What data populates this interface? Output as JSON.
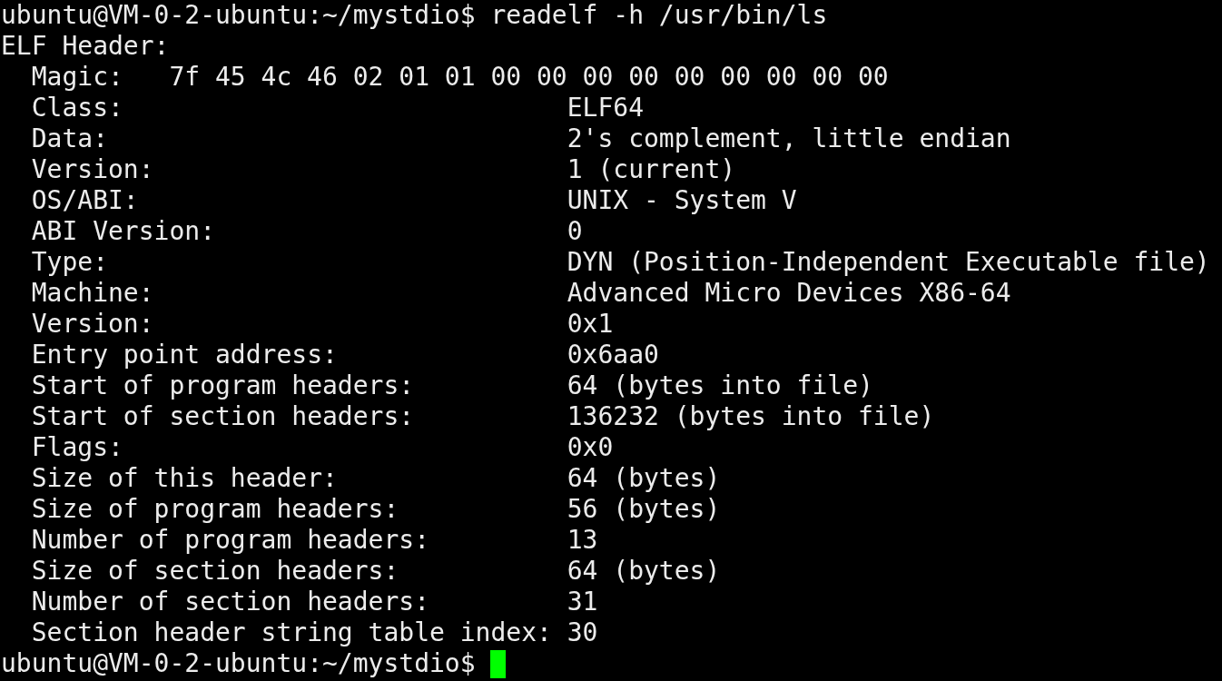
{
  "terminal": {
    "lines": [
      {
        "kind": "prompt",
        "prompt": "ubuntu@VM-0-2-ubuntu:~/mystdio$",
        "command": "readelf -h /usr/bin/ls",
        "cursor": false
      },
      {
        "kind": "heading",
        "text": "ELF Header:"
      },
      {
        "kind": "magic",
        "label": "Magic:",
        "value": "7f 45 4c 46 02 01 01 00 00 00 00 00 00 00 00 00"
      },
      {
        "kind": "field",
        "label": "Class:",
        "value": "ELF64"
      },
      {
        "kind": "field",
        "label": "Data:",
        "value": "2's complement, little endian"
      },
      {
        "kind": "field",
        "label": "Version:",
        "value": "1 (current)"
      },
      {
        "kind": "field",
        "label": "OS/ABI:",
        "value": "UNIX - System V"
      },
      {
        "kind": "field",
        "label": "ABI Version:",
        "value": "0"
      },
      {
        "kind": "field",
        "label": "Type:",
        "value": "DYN (Position-Independent Executable file)"
      },
      {
        "kind": "field",
        "label": "Machine:",
        "value": "Advanced Micro Devices X86-64"
      },
      {
        "kind": "field",
        "label": "Version:",
        "value": "0x1"
      },
      {
        "kind": "field",
        "label": "Entry point address:",
        "value": "0x6aa0"
      },
      {
        "kind": "field",
        "label": "Start of program headers:",
        "value": "64 (bytes into file)"
      },
      {
        "kind": "field",
        "label": "Start of section headers:",
        "value": "136232 (bytes into file)"
      },
      {
        "kind": "field",
        "label": "Flags:",
        "value": "0x0"
      },
      {
        "kind": "field",
        "label": "Size of this header:",
        "value": "64 (bytes)"
      },
      {
        "kind": "field",
        "label": "Size of program headers:",
        "value": "56 (bytes)"
      },
      {
        "kind": "field",
        "label": "Number of program headers:",
        "value": "13"
      },
      {
        "kind": "field",
        "label": "Size of section headers:",
        "value": "64 (bytes)"
      },
      {
        "kind": "field",
        "label": "Number of section headers:",
        "value": "31"
      },
      {
        "kind": "field",
        "label": "Section header string table index:",
        "value": "30"
      },
      {
        "kind": "prompt",
        "prompt": "ubuntu@VM-0-2-ubuntu:~/mystdio$",
        "cursor": true
      }
    ]
  }
}
